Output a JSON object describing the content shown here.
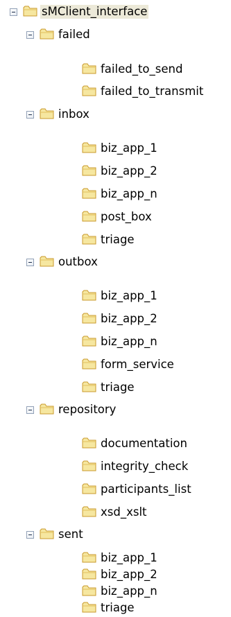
{
  "tree": {
    "root": {
      "label": "sMClient_interface",
      "expanded": true,
      "children": [
        {
          "label": "failed",
          "expanded": true,
          "children": [
            "failed_to_send",
            "failed_to_transmit"
          ]
        },
        {
          "label": "inbox",
          "expanded": true,
          "children": [
            "biz_app_1",
            "biz_app_2",
            "biz_app_n",
            "post_box",
            "triage"
          ]
        },
        {
          "label": "outbox",
          "expanded": true,
          "children": [
            "biz_app_1",
            "biz_app_2",
            "biz_app_n",
            "form_service",
            "triage"
          ]
        },
        {
          "label": "repository",
          "expanded": true,
          "children": [
            "documentation",
            "integrity_check",
            "participants_list",
            "xsd_xslt"
          ]
        },
        {
          "label": "sent",
          "expanded": true,
          "children": [
            "biz_app_1",
            "biz_app_2",
            "biz_app_n",
            "triage"
          ]
        }
      ]
    },
    "icons": {
      "folder": "folder-icon",
      "collapse": "collapse-toggle-icon"
    },
    "colors": {
      "folder_fill": "#f6e7a0",
      "folder_edge": "#c99a2c",
      "toggle_border": "#91a0b6",
      "selection": "#ece9d8"
    }
  }
}
